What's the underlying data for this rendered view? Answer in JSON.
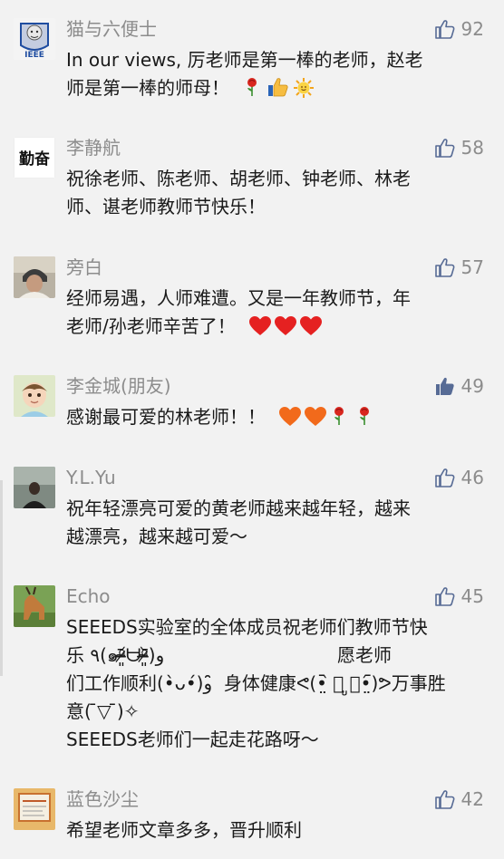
{
  "comments": [
    {
      "name": "猫与六便士",
      "likes": "92",
      "liked": false,
      "avatar_text": "IEEE",
      "lines": [
        "In our views, 厉老师是第一棒的老师，赵老",
        "师是第一棒的师母！"
      ],
      "emoji": [
        "rose-icon",
        "thumbs-up-icon",
        "sun-icon"
      ]
    },
    {
      "name": "李静航",
      "likes": "58",
      "liked": false,
      "avatar_text": "勤奋",
      "lines": [
        "祝徐老师、陈老师、胡老师、钟老师、林老",
        "师、谌老师教师节快乐！"
      ],
      "emoji": []
    },
    {
      "name": "旁白",
      "likes": "57",
      "liked": false,
      "lines": [
        "经师易遇，人师难遭。又是一年教师节，年",
        "老师/孙老师辛苦了！"
      ],
      "emoji": [
        "heart-icon",
        "heart-icon",
        "heart-icon"
      ]
    },
    {
      "name": "李金城(朋友)",
      "likes": "49",
      "liked": true,
      "lines": [
        "感谢最可爱的林老师！！"
      ],
      "emoji": [
        "orange-heart-icon",
        "orange-heart-icon",
        "rose-icon",
        "rose-icon"
      ]
    },
    {
      "name": "Y.L.Yu",
      "likes": "46",
      "liked": false,
      "lines": [
        "祝年轻漂亮可爱的黄老师越来越年轻，越来",
        "越漂亮，越来越可爱～"
      ],
      "emoji": []
    },
    {
      "name": "Echo",
      "likes": "45",
      "liked": false,
      "lines": [
        "SEEEDS实验室的全体成员祝老师们教师节快",
        "乐 ٩(๑ᵒ̴̶̷͈᷄ᗨᵒ̴̶̷͈᷅)و                              愿老师",
        "们工作顺利(•̀ᴗ•́)و ̑̑ 身体健康ᕙ(•̤᷆ ॒ ູ॒•̤᷇)ᕗ万事胜",
        "意( ̄▽ ̄)✧",
        "SEEEDS老师们一起走花路呀～"
      ],
      "emoji": []
    },
    {
      "name": "蓝色沙尘",
      "likes": "42",
      "liked": false,
      "lines": [
        "希望老师文章多多，晋升顺利"
      ],
      "emoji": []
    }
  ],
  "colors": {
    "name": "#8c8c8c",
    "text": "#1a1a1a",
    "like_outline": "#576b95",
    "like_filled": "#576b95",
    "background": "#f2f2f2"
  }
}
